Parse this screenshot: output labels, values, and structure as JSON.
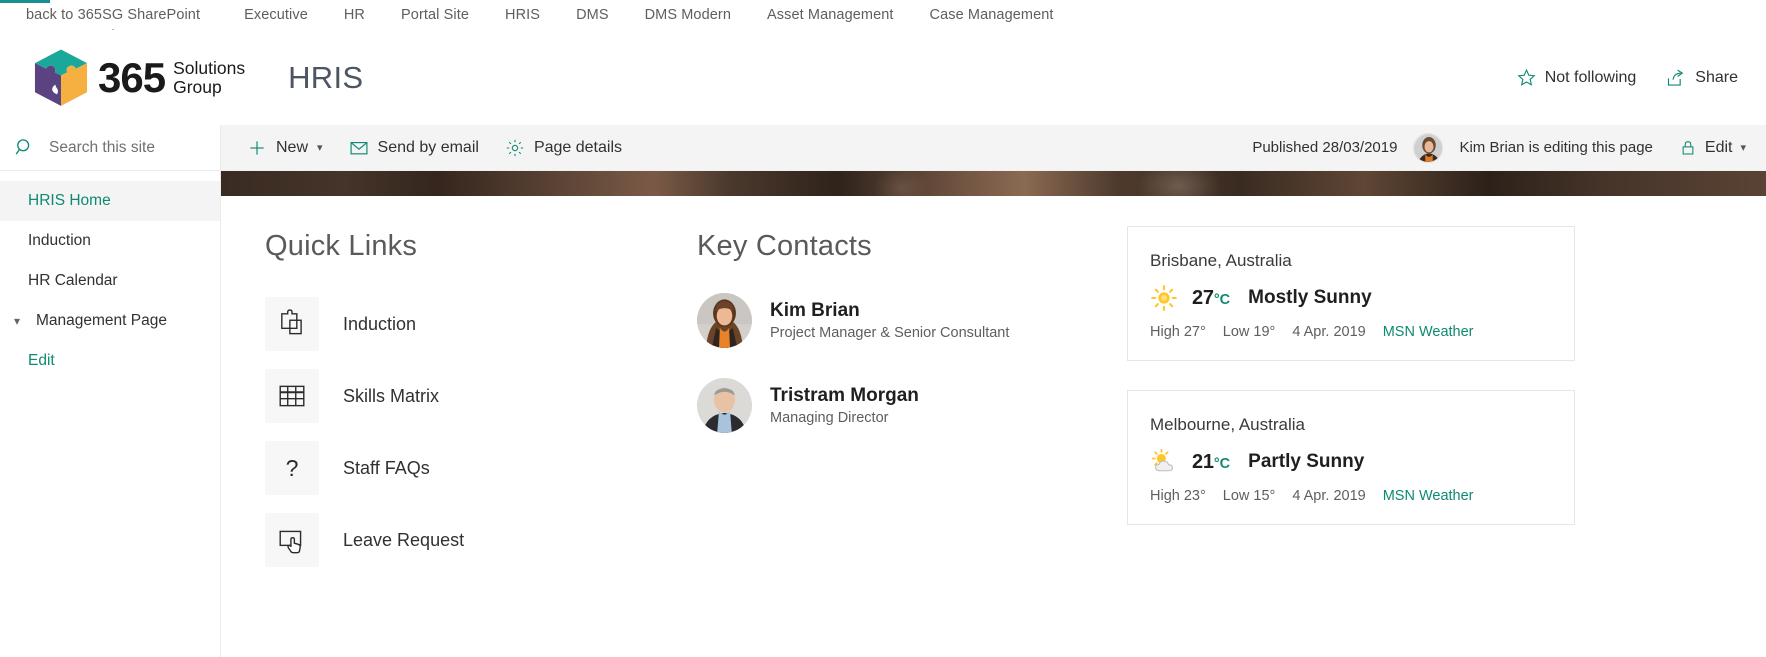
{
  "suite_nav": {
    "items": [
      {
        "label": "back to 365SG SharePoint",
        "active": true
      },
      {
        "label": "Executive",
        "active": false
      },
      {
        "label": "HR",
        "active": false
      },
      {
        "label": "Portal Site",
        "active": false
      },
      {
        "label": "HRIS",
        "active": false
      },
      {
        "label": "DMS",
        "active": false
      },
      {
        "label": "DMS Modern",
        "active": false
      },
      {
        "label": "Asset Management",
        "active": false
      },
      {
        "label": "Case Management",
        "active": false
      }
    ]
  },
  "header": {
    "logo_number": "365",
    "logo_line1": "Solutions",
    "logo_line2": "Group",
    "site_title": "HRIS",
    "follow_label": "Not following",
    "share_label": "Share"
  },
  "command_bar": {
    "new_label": "New",
    "send_email_label": "Send by email",
    "page_details_label": "Page details",
    "published_label": "Published 28/03/2019",
    "editing_label": "Kim Brian is editing this page",
    "edit_label": "Edit"
  },
  "left_nav": {
    "search_placeholder": "Search this site",
    "items": [
      {
        "label": "HRIS Home",
        "active": true,
        "chevron": false
      },
      {
        "label": "Induction",
        "active": false,
        "chevron": false
      },
      {
        "label": "HR Calendar",
        "active": false,
        "chevron": false
      },
      {
        "label": "Management Page",
        "active": false,
        "chevron": true
      },
      {
        "label": "Edit",
        "active": false,
        "chevron": false,
        "is_edit": true
      }
    ]
  },
  "quick_links": {
    "title": "Quick Links",
    "items": [
      {
        "label": "Induction",
        "icon": "clipboard-icon"
      },
      {
        "label": "Skills Matrix",
        "icon": "table-grid-icon"
      },
      {
        "label": "Staff FAQs",
        "icon": "question-mark-icon"
      },
      {
        "label": "Leave Request",
        "icon": "screen-tap-icon"
      }
    ]
  },
  "key_contacts": {
    "title": "Key Contacts",
    "items": [
      {
        "name": "Kim Brian",
        "role": "Project Manager & Senior Consultant"
      },
      {
        "name": "Tristram Morgan",
        "role": "Managing Director"
      }
    ]
  },
  "weather": {
    "cards": [
      {
        "city": "Brisbane, Australia",
        "temp": "27",
        "unit": "°C",
        "condition": "Mostly Sunny",
        "icon": "sun-icon",
        "high": "High 27°",
        "low": "Low 19°",
        "date": "4 Apr. 2019",
        "source": "MSN Weather"
      },
      {
        "city": "Melbourne, Australia",
        "temp": "21",
        "unit": "°C",
        "condition": "Partly Sunny",
        "icon": "sun-cloud-icon",
        "high": "High 23°",
        "low": "Low 15°",
        "date": "4 Apr. 2019",
        "source": "MSN Weather"
      }
    ]
  },
  "colors": {
    "accent_teal": "#0e8a72",
    "nav_accent": "#1b8f8f",
    "logo_teal": "#1aa89a",
    "logo_purple": "#5b4382",
    "logo_orange": "#f5b041",
    "sun_yellow": "#ffc627",
    "command_bar_bg": "#f4f4f4"
  }
}
